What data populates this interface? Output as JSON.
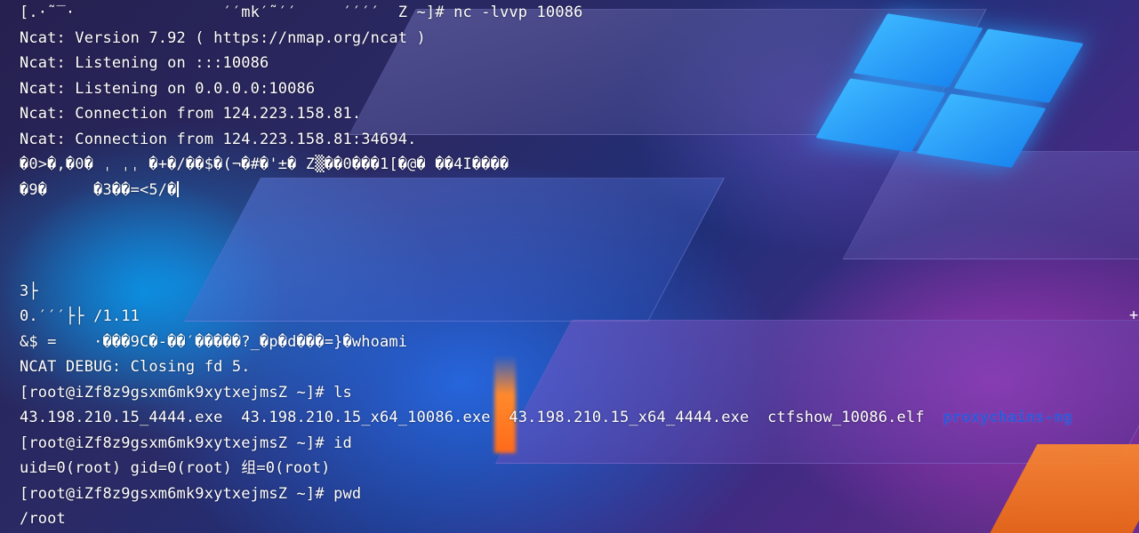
{
  "terminal": {
    "lines": [
      "[.·˜‾·                ′′mk′˜′′     ′′′′  Z ~]# nc -lvvp 10086",
      "Ncat: Version 7.92 ( https://nmap.org/ncat )",
      "Ncat: Listening on :::10086",
      "Ncat: Listening on 0.0.0.0:10086",
      "Ncat: Connection from 124.223.158.81.",
      "Ncat: Connection from 124.223.158.81:34694.",
      "�0>�,�0� ˌ ˌˌ �+�/��$�(¬�#�'±� Z▒��0���1[�@� ��4I����",
      "�9�     �3��=<5/�",
      "3├",
      "0.′′′├├ /1.11",
      "&$ =    ·���9C�-��′�����?_�p�d���=}�whoami",
      "NCAT DEBUG: Closing fd 5.",
      "[root@iZf8z9gsxm6mk9xytxejmsZ ~]# ls",
      "43.198.210.15_4444.exe  43.198.210.15_x64_10086.exe  43.198.210.15_x64_4444.exe  ctfshow_10086.elf  ",
      "[root@iZf8z9gsxm6mk9xytxejmsZ ~]# id",
      "uid=0(root) gid=0(root) 组=0(root)",
      "[root@iZf8z9gsxm6mk9xytxejmsZ ~]# pwd",
      "/root"
    ],
    "directory_entry": "proxychains-ng",
    "edge_mark": "+"
  },
  "colors": {
    "text": "#ffffff",
    "directory": "#2f55d9",
    "windows_logo": "#2aa0ff"
  },
  "icons": {
    "wallpaper_logo": "windows-logo-icon"
  }
}
